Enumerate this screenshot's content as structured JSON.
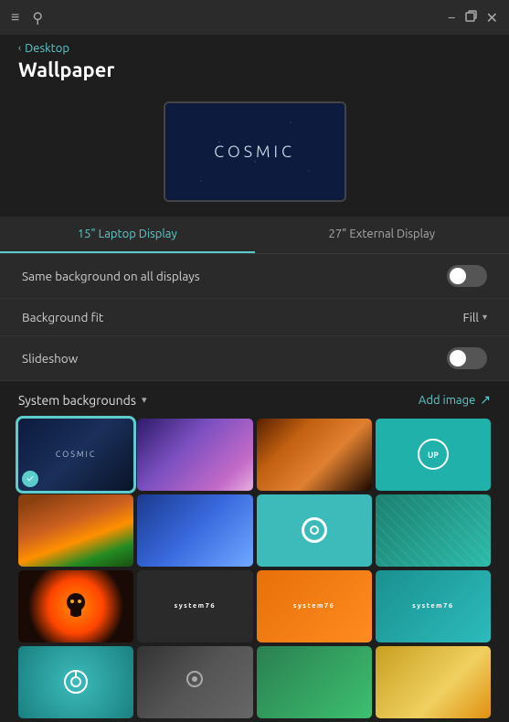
{
  "titlebar": {
    "menu_icon": "≡",
    "search_icon": "🔍",
    "minimize_icon": "−",
    "restore_icon": "⧉",
    "close_icon": "✕"
  },
  "header": {
    "breadcrumb_label": "Desktop",
    "page_title": "Wallpaper"
  },
  "preview": {
    "text": "COSMIC"
  },
  "tabs": [
    {
      "label": "15\" Laptop Display",
      "active": true
    },
    {
      "label": "27\" External Display",
      "active": false
    }
  ],
  "settings": [
    {
      "label": "Same background on all displays",
      "type": "toggle",
      "value": false
    },
    {
      "label": "Background fit",
      "type": "dropdown",
      "value": "Fill"
    },
    {
      "label": "Slideshow",
      "type": "toggle",
      "value": false
    }
  ],
  "section": {
    "title": "System backgrounds",
    "add_label": "Add image"
  },
  "wallpapers": [
    {
      "id": "cosmic",
      "type": "cosmic",
      "selected": true
    },
    {
      "id": "purple",
      "type": "purple",
      "selected": false
    },
    {
      "id": "nebula",
      "type": "nebula",
      "selected": false
    },
    {
      "id": "potential-teal",
      "type": "potential-teal",
      "selected": false
    },
    {
      "id": "forest",
      "type": "forest",
      "selected": false
    },
    {
      "id": "blue-crystals",
      "type": "blue-crystals",
      "selected": false
    },
    {
      "id": "pop-os",
      "type": "pop-os",
      "selected": false
    },
    {
      "id": "scale",
      "type": "scale",
      "selected": false
    },
    {
      "id": "spooky",
      "type": "spooky",
      "selected": false
    },
    {
      "id": "sys76-dark",
      "type": "sys76-dark",
      "selected": false
    },
    {
      "id": "sys76-orange",
      "type": "sys76-orange",
      "selected": false
    },
    {
      "id": "sys76-teal",
      "type": "sys76-teal",
      "selected": false
    },
    {
      "id": "last1",
      "type": "last1",
      "selected": false
    },
    {
      "id": "last2",
      "type": "last2",
      "selected": false
    },
    {
      "id": "last3",
      "type": "last3",
      "selected": false
    },
    {
      "id": "last4",
      "type": "last4",
      "selected": false
    }
  ]
}
